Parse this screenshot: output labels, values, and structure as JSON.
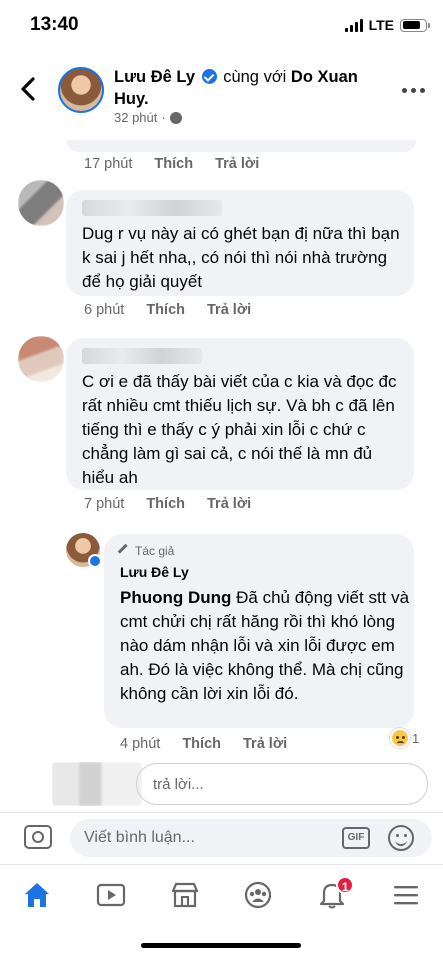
{
  "status_bar": {
    "time": "13:40",
    "network": "LTE",
    "battery_level": 0.8
  },
  "post": {
    "author": "Lưu Đê Ly",
    "with_text": "cùng với",
    "tagged": "Do Xuan Huy.",
    "time": "32 phút",
    "privacy_icon": "globe-icon"
  },
  "comments": [
    {
      "time": "17 phút",
      "like": "Thích",
      "reply": "Trả lời"
    },
    {
      "text": "Dug r vụ này ai có ghét bạn đị nữa thì bạn k sai j hết nha,, có nói thì nói nhà trường để họ giải quyết",
      "time": "6 phút",
      "like": "Thích",
      "reply": "Trả lời"
    },
    {
      "text": "C ơi e đã thấy bài viết của c kia và đọc đc rất nhiều cmt thiếu lịch sự. Và bh c đã lên tiếng thì e thấy c ý phải xin lỗi c chứ c chẳng làm gì sai cả, c nói thế là mn đủ hiểu ah",
      "time": "7 phút",
      "like": "Thích",
      "reply": "Trả lời"
    }
  ],
  "author_reply": {
    "badge": "Tác giả",
    "name": "Lưu Đê Ly",
    "mention": "Phuong Dung",
    "text": " Đã chủ động viết stt và cmt chửi chị rất hăng rồi thì khó lòng nào dám nhận lỗi và xin lỗi được em ah. Đó là việc không thể. Mà chị cũng không cần lời xin lỗi đó.",
    "time": "4 phút",
    "like": "Thích",
    "reply": "Trả lời",
    "reaction_count": "1"
  },
  "reply_input": {
    "placeholder": "trả lời..."
  },
  "composer": {
    "placeholder": "Viết bình luận...",
    "gif": "GIF"
  },
  "nav": {
    "notification_count": "1"
  },
  "colors": {
    "accent": "#1b74e4",
    "bubble": "#f0f2f5",
    "muted": "#65676b",
    "badge": "#e41e3f"
  }
}
